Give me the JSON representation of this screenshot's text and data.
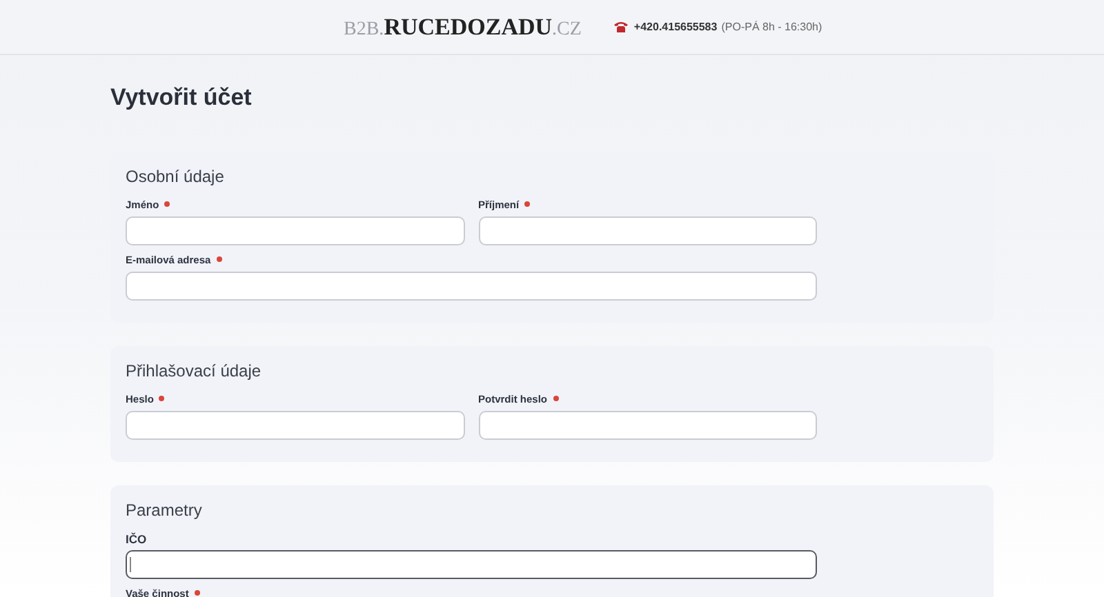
{
  "header": {
    "logo": {
      "prefix": "B2B.",
      "name": "RUCEDOZADU",
      "suffix": ".CZ"
    },
    "phone": "+420.415655583",
    "hours": "(PO-PÁ 8h - 16:30h)"
  },
  "page_title": "Vytvořit účet",
  "sections": [
    {
      "title": "Osobní údaje",
      "fields": [
        {
          "label": "Jméno",
          "required": true,
          "kind": "half",
          "focused": false
        },
        {
          "label": "Příjmení",
          "required": true,
          "kind": "half",
          "focused": false
        },
        {
          "label": "E-mailová adresa",
          "required": true,
          "kind": "full",
          "focused": false
        }
      ]
    },
    {
      "title": "Přihlašovací údaje",
      "fields": [
        {
          "label": "Heslo",
          "required": true,
          "kind": "half",
          "focused": false
        },
        {
          "label": "Potvrdit heslo",
          "required": true,
          "kind": "half",
          "focused": false
        }
      ]
    },
    {
      "title": "Parametry",
      "fields": [
        {
          "label": "IČO",
          "required": false,
          "kind": "full",
          "focused": true
        },
        {
          "label": "Vaše činnost",
          "required": true,
          "kind": "clipped",
          "focused": false
        }
      ]
    }
  ]
}
